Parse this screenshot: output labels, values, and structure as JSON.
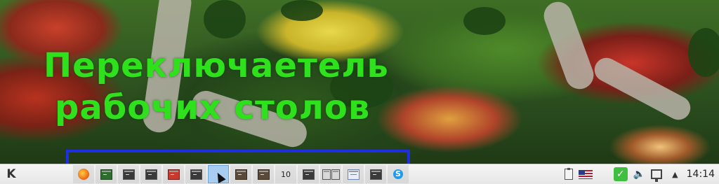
{
  "caption": {
    "line1": "Переключаетель",
    "line2": "рабочих столов"
  },
  "taskbar": {
    "launcher_icon": "kde-logo-icon",
    "launcher_glyph": "K",
    "pager": {
      "desktops": [
        {
          "index": 1,
          "icon": "firefox-icon"
        },
        {
          "index": 2,
          "icon": "terminal-green-icon"
        },
        {
          "index": 3,
          "icon": "terminal-icon"
        },
        {
          "index": 4,
          "icon": "terminal-icon"
        },
        {
          "index": 5,
          "icon": "red-app-icon"
        },
        {
          "index": 6,
          "icon": "terminal-icon"
        },
        {
          "index": 7,
          "icon": "empty",
          "active": true
        },
        {
          "index": 8,
          "icon": "gimp-icon"
        },
        {
          "index": 9,
          "icon": "gimp-icon"
        },
        {
          "index": 10,
          "label": "10"
        },
        {
          "index": 11,
          "icon": "terminal-icon"
        },
        {
          "index": 12,
          "icon": "dotted-window-icon"
        },
        {
          "index": 13,
          "icon": "document-icon"
        },
        {
          "index": 14,
          "icon": "terminal-icon"
        },
        {
          "index": 15,
          "icon": "skype-icon"
        }
      ]
    },
    "tray": {
      "clipboard_icon": "clipboard-icon",
      "keyboard_layout_icon": "us-flag-icon",
      "updates_icon": "checkmark-icon",
      "volume_icon": "speaker-icon",
      "network_icon": "network-icon",
      "expand_icon": "triangle-up-icon",
      "expand_glyph": "▲",
      "volume_glyph": "🔈",
      "check_glyph": "✓",
      "clock": "14:14"
    }
  },
  "colors": {
    "caption": "#2fe01c",
    "highlight_bracket": "#1e2ee0",
    "active_desktop": "#a9cdf0"
  }
}
